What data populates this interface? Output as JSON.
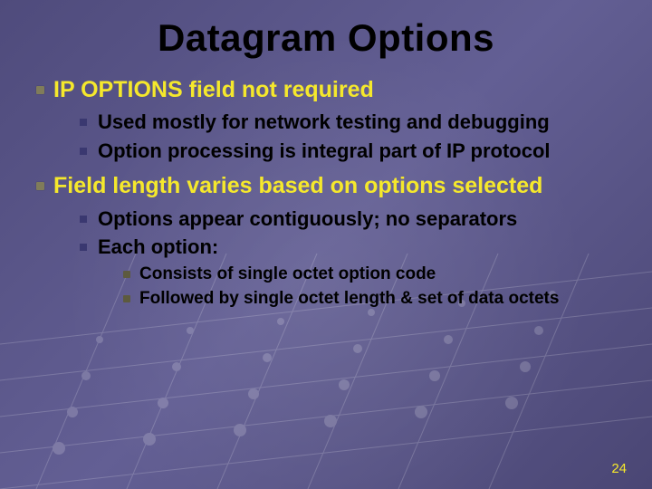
{
  "title": "Datagram Options",
  "bullets": {
    "b1": "IP OPTIONS field not required",
    "b1_1": "Used mostly for network testing and debugging",
    "b1_2": "Option processing is integral part of IP protocol",
    "b2": "Field length varies based on options selected",
    "b2_1": "Options appear contiguously; no separators",
    "b2_2": "Each option:",
    "b2_2_1": "Consists of single octet option code",
    "b2_2_2": "Followed by single octet length & set of data octets"
  },
  "page_number": "24"
}
